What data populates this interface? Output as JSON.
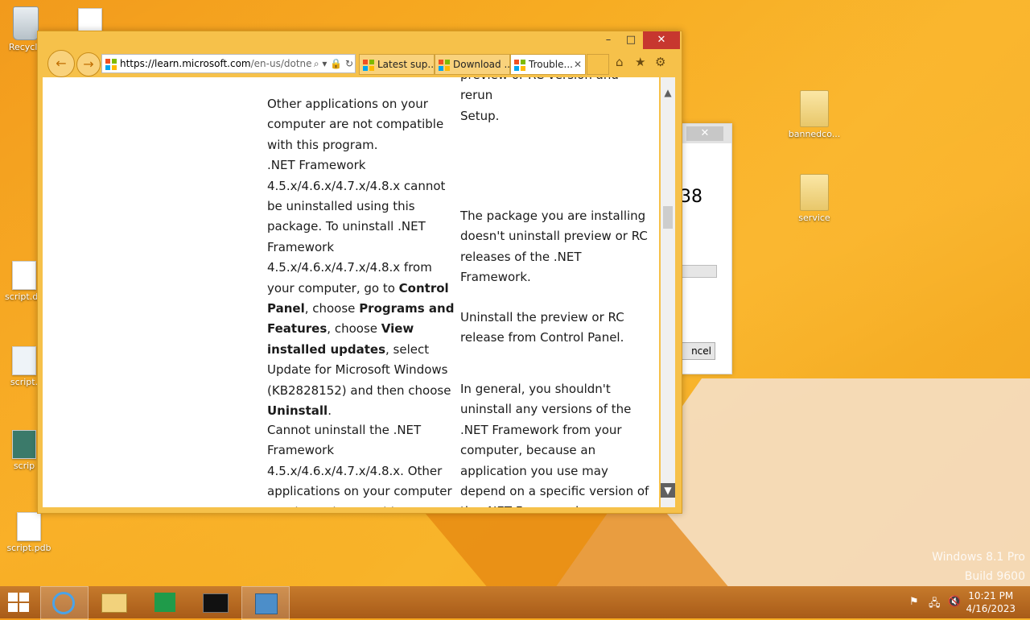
{
  "desktop": {
    "icons": [
      {
        "label": "Recycle",
        "type": "bin"
      },
      {
        "label": "script.de",
        "type": "file"
      },
      {
        "label": "script.",
        "type": "gear"
      },
      {
        "label": "scrip",
        "type": "app"
      },
      {
        "label": "script.pdb",
        "type": "file"
      },
      {
        "label": "bannedco...",
        "type": "folder"
      },
      {
        "label": "service",
        "type": "folder"
      }
    ],
    "watermark": {
      "line1": "Windows 8.1 Pro",
      "line2": "Build 9600"
    }
  },
  "background_dialog": {
    "close_glyph": "✕",
    "number_fragment": "38",
    "button_fragment": "ncel"
  },
  "browser": {
    "window_controls": {
      "minimize": "–",
      "maximize": "□",
      "close": "✕"
    },
    "address": {
      "url_prefix": "https://learn.",
      "url_bold": "microsoft.com",
      "url_suffix": "/en-us/dotne",
      "tools": "⌕ ▾ 🔒 ↻"
    },
    "tabs": [
      {
        "label": "Latest sup...",
        "active": false
      },
      {
        "label": "Download ...",
        "active": false
      },
      {
        "label": "Trouble...",
        "active": true,
        "close": "✕"
      }
    ],
    "toolbar_icons": {
      "home": "⌂",
      "favorites": "★",
      "settings": "⚙"
    },
    "nav": {
      "back": "←",
      "forward": "→"
    }
  },
  "page": {
    "right_top_fragment_1": "preview or RC version and rerun",
    "right_top_fragment_2": "Setup.",
    "left_block1": {
      "p1": "Other applications on your computer are not compatible with this program.",
      "p2_a": ".NET Framework 4.5.x/4.6.x/4.7.x/4.8.x cannot be uninstalled using this package. To uninstall .NET Framework 4.5.x/4.6.x/4.7.x/4.8.x from your computer, go to ",
      "p2_b1": "Control Panel",
      "p2_c": ", choose ",
      "p2_b2": "Programs and Features",
      "p2_d": ", choose ",
      "p2_b3": "View installed updates",
      "p2_e": ", select Update for Microsoft Windows (KB2828152) and then choose ",
      "p2_b4": "Uninstall",
      "p2_f": "."
    },
    "right_block1": {
      "p1": "The package you are installing doesn't uninstall preview or RC releases of the .NET Framework.",
      "p2": "Uninstall the preview or RC release from Control Panel."
    },
    "right_block2": "In general, you shouldn't uninstall any versions of the .NET Framework from your computer, because an application you use may depend on a specific version of the .NET Framework.",
    "left_block2": "Cannot uninstall the .NET Framework 4.5.x/4.6.x/4.7.x/4.8.x. Other applications on your computer are dependent on this",
    "scroll_up": "▲",
    "scroll_down": "▼"
  },
  "taskbar": {
    "clock_time": "10:21 PM",
    "clock_date": "4/16/2023",
    "tray_icons": {
      "flag": "⚑",
      "network": "🖧",
      "volume": "🔇"
    }
  }
}
